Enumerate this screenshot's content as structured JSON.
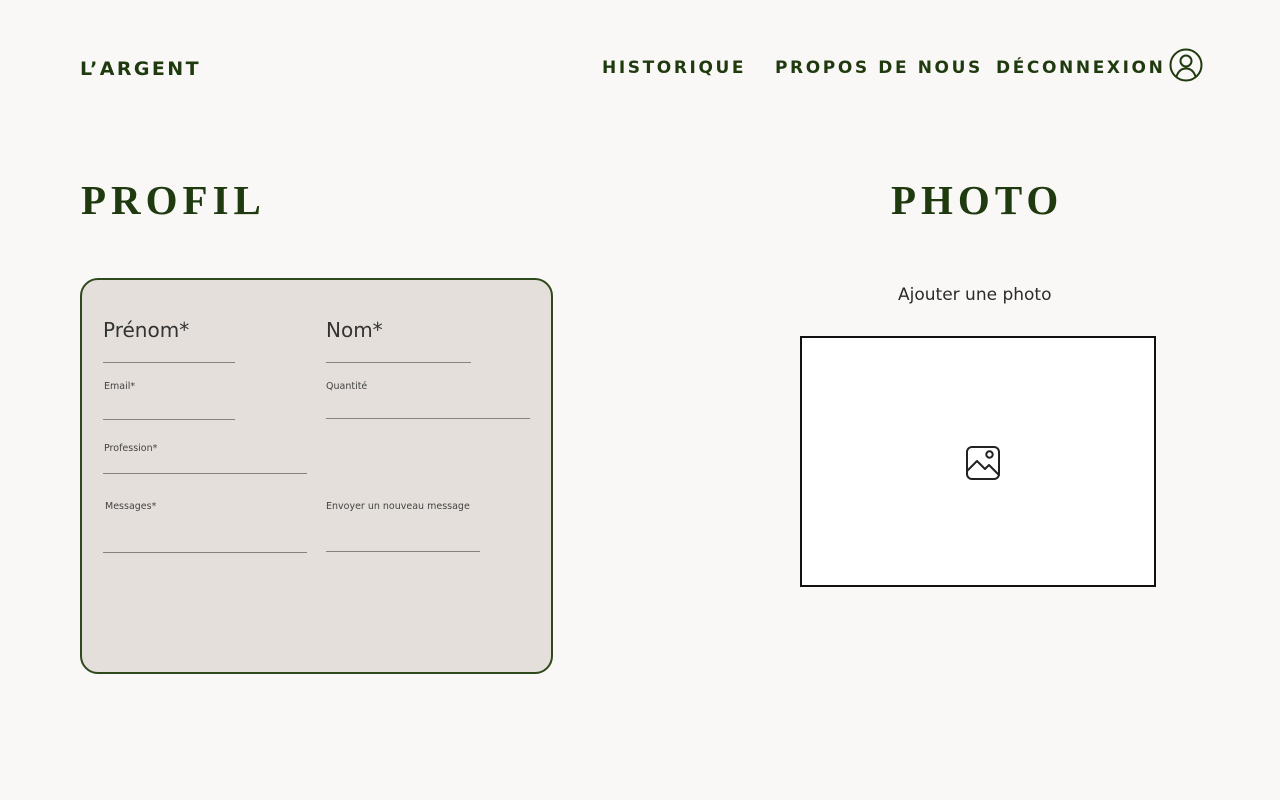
{
  "header": {
    "brand": "L’ARGENT",
    "nav": [
      {
        "label": "HISTORIQUE"
      },
      {
        "label": "PROPOS DE NOUS"
      },
      {
        "label": "DÉCONNEXION"
      }
    ],
    "account_icon": "user-circle-icon"
  },
  "profile": {
    "title": "PROFIL",
    "fields": {
      "first_name": {
        "label": "Prénom*",
        "value": ""
      },
      "last_name": {
        "label": "Nom*",
        "value": ""
      },
      "email": {
        "label": "Email*",
        "value": ""
      },
      "quantity": {
        "label": "Quantité",
        "value": ""
      },
      "profession": {
        "label": "Profession*",
        "value": ""
      },
      "messages": {
        "label": "Messages*",
        "value": ""
      },
      "new_message": {
        "label": "Envoyer un nouveau message",
        "value": ""
      }
    }
  },
  "photo": {
    "title": "PHOTO",
    "caption": "Ajouter une photo",
    "placeholder_icon": "image-icon"
  },
  "colors": {
    "background": "#f9f8f6",
    "accent": "#1f3a0e",
    "card_background": "#e4dfda",
    "card_border": "#2e4a1c"
  }
}
